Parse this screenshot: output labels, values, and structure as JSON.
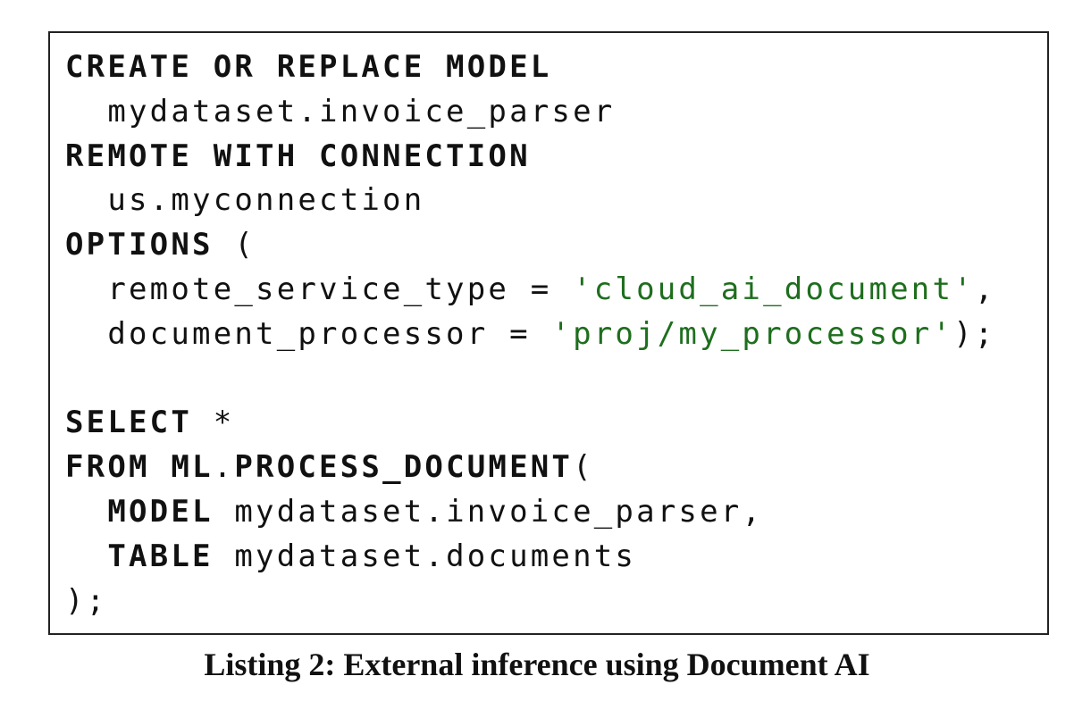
{
  "listing": {
    "lines": [
      [
        {
          "text": "CREATE OR REPLACE MODEL",
          "kind": "kw"
        }
      ],
      [
        {
          "text": "  mydataset.invoice_parser",
          "kind": "plain"
        }
      ],
      [
        {
          "text": "REMOTE WITH CONNECTION",
          "kind": "kw"
        }
      ],
      [
        {
          "text": "  us.myconnection",
          "kind": "plain"
        }
      ],
      [
        {
          "text": "OPTIONS",
          "kind": "kw"
        },
        {
          "text": " (",
          "kind": "plain"
        }
      ],
      [
        {
          "text": "  remote_service_type = ",
          "kind": "plain"
        },
        {
          "text": "'cloud_ai_document'",
          "kind": "str"
        },
        {
          "text": ",",
          "kind": "plain"
        }
      ],
      [
        {
          "text": "  document_processor = ",
          "kind": "plain"
        },
        {
          "text": "'proj/my_processor'",
          "kind": "str"
        },
        {
          "text": ");",
          "kind": "plain"
        }
      ],
      [
        {
          "text": "",
          "kind": "plain"
        }
      ],
      [
        {
          "text": "SELECT",
          "kind": "kw"
        },
        {
          "text": " *",
          "kind": "plain"
        }
      ],
      [
        {
          "text": "FROM ML",
          "kind": "kw"
        },
        {
          "text": ".",
          "kind": "plain"
        },
        {
          "text": "PROCESS_DOCUMENT",
          "kind": "kw"
        },
        {
          "text": "(",
          "kind": "plain"
        }
      ],
      [
        {
          "text": "  ",
          "kind": "plain"
        },
        {
          "text": "MODEL",
          "kind": "kw"
        },
        {
          "text": " mydataset.invoice_parser,",
          "kind": "plain"
        }
      ],
      [
        {
          "text": "  ",
          "kind": "plain"
        },
        {
          "text": "TABLE",
          "kind": "kw"
        },
        {
          "text": " mydataset.documents",
          "kind": "plain"
        }
      ],
      [
        {
          "text": ");",
          "kind": "plain"
        }
      ]
    ]
  },
  "caption": "Listing 2: External inference using Document AI",
  "colors": {
    "string_literal": "#1e6e1e",
    "text": "#111111",
    "border": "#222222"
  }
}
